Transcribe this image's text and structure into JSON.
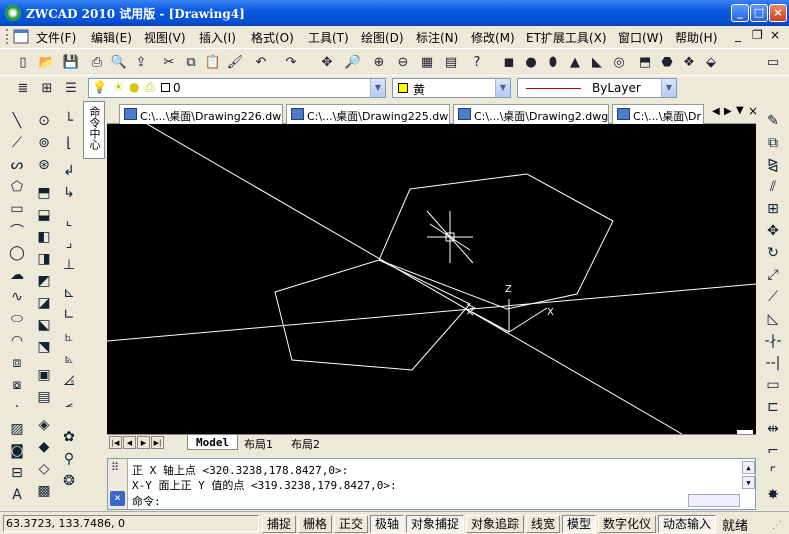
{
  "window": {
    "title": "ZWCAD 2010 试用版 - [Drawing4]",
    "minimize_label": "_",
    "maximize_label": "□",
    "close_label": "×"
  },
  "menu": [
    "文件(F)",
    "编辑(E)",
    "视图(V)",
    "插入(I)",
    "格式(O)",
    "工具(T)",
    "绘图(D)",
    "标注(N)",
    "修改(M)",
    "ET扩展工具(X)",
    "窗口(W)",
    "帮助(H)"
  ],
  "mdi_controls": [
    "_",
    "❐",
    "×"
  ],
  "layer_toolbar": {
    "layer_value": "0",
    "color_value": "黄",
    "linetype_value": "ByLayer"
  },
  "drawing_tabs": [
    "C:\\...\\桌面\\Drawing226.dwg",
    "C:\\...\\桌面\\Drawing225.dwg",
    "C:\\...\\桌面\\Drawing2.dwg",
    "C:\\...\\桌面\\Dr"
  ],
  "side_panel_tab": "命令中心",
  "layout_tabs": [
    "Model",
    "布局1",
    "布局2"
  ],
  "ucs_labels": {
    "z": "Z",
    "x": "X"
  },
  "command_line": {
    "history": [
      "正 X 轴上点 <320.3238,178.8427,0>:",
      "X-Y 面上正 Y 值的点 <319.3238,179.8427,0>:"
    ],
    "prompt": "命令:"
  },
  "status": {
    "coords": "63.3723, 133.7486, 0",
    "buttons": [
      {
        "label": "捕捉",
        "on": false
      },
      {
        "label": "栅格",
        "on": false
      },
      {
        "label": "正交",
        "on": false
      },
      {
        "label": "极轴",
        "on": true
      },
      {
        "label": "对象捕捉",
        "on": true
      },
      {
        "label": "对象追踪",
        "on": false
      },
      {
        "label": "线宽",
        "on": false
      },
      {
        "label": "模型",
        "on": true
      },
      {
        "label": "数字化仪",
        "on": false
      },
      {
        "label": "动态输入",
        "on": true
      }
    ],
    "ready": "就绪"
  },
  "colors": {
    "canvas_bg": "#000000",
    "geometry": "#ffffff",
    "titlebar": "#0a5ae0",
    "color_swatch": "#ffff00"
  }
}
